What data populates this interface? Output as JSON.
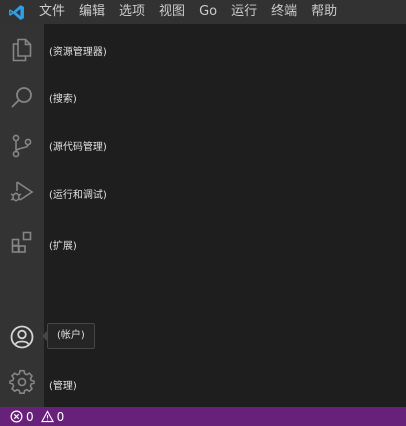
{
  "menubar": {
    "items": [
      "文件",
      "编辑",
      "选项",
      "视图",
      "Go",
      "运行",
      "终端",
      "帮助"
    ]
  },
  "activity_bar": {
    "explorer": {
      "icon": "files-icon",
      "label": "(资源管理器)"
    },
    "search": {
      "icon": "search-icon",
      "label": "(搜索)"
    },
    "scm": {
      "icon": "source-control-icon",
      "label": "(源代码管理)"
    },
    "debug": {
      "icon": "run-debug-icon",
      "label": "(运行和调试)"
    },
    "extensions": {
      "icon": "extensions-icon",
      "label": "(扩展)"
    },
    "accounts": {
      "icon": "account-icon",
      "tooltip": "(帐户)"
    },
    "manage": {
      "icon": "gear-icon",
      "label": "(管理)"
    }
  },
  "statusbar": {
    "errors": "0",
    "warnings": "0",
    "background": "#68217a"
  },
  "colors": {
    "menubar": "#323233",
    "activity_bar": "#333333",
    "editor": "#1e1e1e",
    "vscode_blue": "#007acc"
  }
}
